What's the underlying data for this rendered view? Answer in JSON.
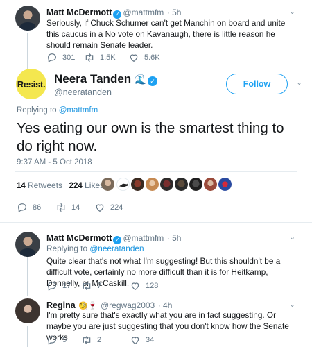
{
  "tweet1": {
    "name": "Matt McDermott",
    "handle": "@mattmfm",
    "time": "· 5h",
    "text": "Seriously, if Chuck Schumer can't get Manchin on board and unite this caucus in a No vote on Kavanaugh, there is little reason he should remain Senate leader.",
    "replies": "301",
    "retweets": "1.5K",
    "likes": "5.6K"
  },
  "main_tweet": {
    "avatar_text": "Resist.",
    "name": "Neera Tanden",
    "name_emoji": "🌊",
    "handle": "@neeratanden",
    "follow_label": "Follow",
    "replying_prefix": "Replying to",
    "replying_handle": "@mattmfm",
    "text": "Yes eating our own is the smartest thing to do right now.",
    "timestamp": "9:37 AM - 5 Oct 2018",
    "retweets_count": "14",
    "retweets_label": "Retweets",
    "likes_count": "224",
    "likes_label": "Likes",
    "replies": "86",
    "retweets": "14",
    "likes": "224"
  },
  "reply1": {
    "name": "Matt McDermott",
    "handle": "@mattmfm",
    "time": "· 5h",
    "replying_prefix": "Replying to",
    "replying_handle": "@neeratanden",
    "text": "Quite clear that's not what I'm suggesting! But this shouldn't be a difficult vote, certainly no more difficult than it is for Heitkamp, Donnelly, or McCaskill.",
    "replies": "17",
    "retweets": "7",
    "likes": "128"
  },
  "reply2": {
    "name": "Regina",
    "name_emoji": "🧐🍷",
    "handle": "@regwag2003",
    "time": "· 4h",
    "text": "I'm pretty sure that's exactly what you are in fact suggesting. Or maybe you are just suggesting that you don't know how the Senate works",
    "replies": "5",
    "retweets": "2",
    "likes": "34"
  },
  "colors": {
    "accent": "#1da1f2",
    "secondary_text": "#657786",
    "link": "#1b95e0",
    "divider": "#e6ecf0"
  },
  "icons": [
    "reply-icon",
    "retweet-icon",
    "like-icon",
    "verified-icon",
    "caret-down-icon"
  ]
}
